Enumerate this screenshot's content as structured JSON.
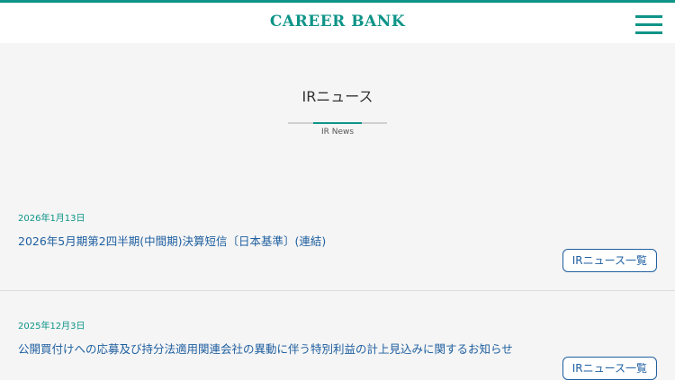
{
  "header": {
    "logo_text": "CAREER BANK"
  },
  "page": {
    "title": "IRニュース",
    "subtitle": "IR News"
  },
  "news": [
    {
      "date": "2026年1月13日",
      "title": "2026年5月期第2四半期(中間期)決算短信〔日本基準〕(連結)",
      "button_label": "IRニュース一覧"
    },
    {
      "date": "2025年12月3日",
      "title": "公開買付けへの応募及び持分法適用関連会社の異動に伴う特別利益の計上見込みに関するお知らせ",
      "button_label": "IRニュース一覧"
    }
  ],
  "colors": {
    "accent": "#0e9488",
    "link": "#1f5fa0",
    "background": "#f5f5f5"
  },
  "icons": {
    "menu": "hamburger-menu-icon"
  }
}
